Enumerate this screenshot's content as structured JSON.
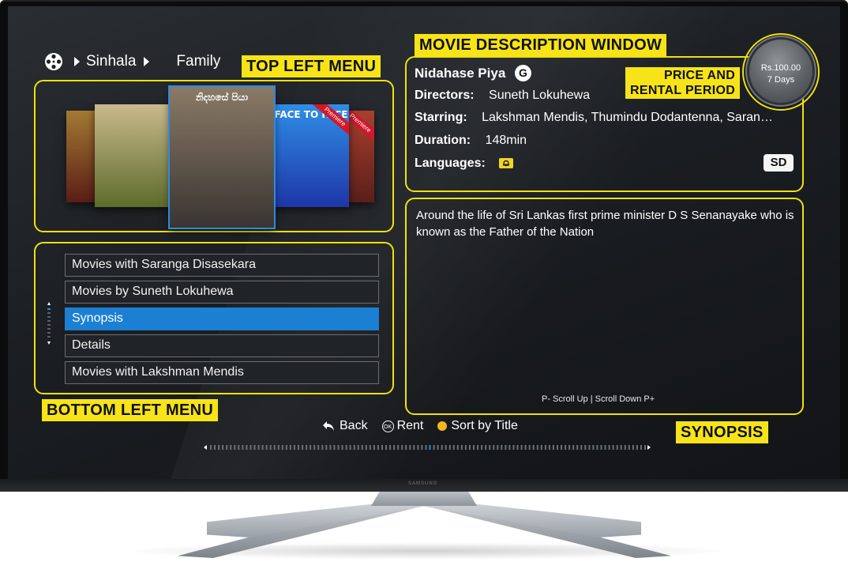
{
  "breadcrumb": {
    "items": [
      "Sinhala",
      "Family"
    ]
  },
  "callouts": {
    "top_left_menu": "TOP LEFT MENU",
    "bottom_left_menu": "BOTTOM LEFT MENU",
    "movie_description": "MOVIE DESCRIPTION WINDOW",
    "price_rental_line1": "PRICE AND",
    "price_rental_line2": "RENTAL PERIOD",
    "synopsis": "SYNOPSIS"
  },
  "posters": [
    {
      "title": "",
      "colors": [
        "#5a1d16",
        "#a37a34"
      ],
      "selected": false,
      "premiere": false
    },
    {
      "title": "",
      "colors": [
        "#5d6b2a",
        "#c9b98c"
      ],
      "selected": false,
      "premiere": false
    },
    {
      "title": "නිදහසේ පියා",
      "colors": [
        "#3a3532",
        "#8a7a66"
      ],
      "selected": true,
      "premiere": false
    },
    {
      "title": "FACE TO FACE",
      "colors": [
        "#1e36a8",
        "#2f8ee6"
      ],
      "selected": false,
      "premiere": true
    },
    {
      "title": "",
      "colors": [
        "#5a1f1a",
        "#a8402d"
      ],
      "selected": false,
      "premiere": true
    }
  ],
  "premiere_label": "Premiere",
  "menu": {
    "items": [
      {
        "label": "Movies with Saranga Disasekara",
        "selected": false
      },
      {
        "label": "Movies by Suneth Lokuhewa",
        "selected": false
      },
      {
        "label": "Synopsis",
        "selected": true
      },
      {
        "label": "Details",
        "selected": false
      },
      {
        "label": "Movies with Lakshman Mendis",
        "selected": false
      }
    ]
  },
  "movie": {
    "title": "Nidahase Piya",
    "rating": "G",
    "directors_label": "Directors:",
    "directors": "Suneth Lokuhewa",
    "starring_label": "Starring:",
    "starring": "Lakshman Mendis, Thumindu Dodantenna, Saran…",
    "duration_label": "Duration:",
    "duration": "148min",
    "languages_label": "Languages:",
    "quality": "SD"
  },
  "price": {
    "amount": "Rs.100.00",
    "period": "7 Days"
  },
  "synopsis": {
    "text": "Around the life of Sri Lankas first prime minister D S Senanayake who is known as the Father of the Nation",
    "scroll_hint": "P- Scroll Up | Scroll Down P+"
  },
  "footer": {
    "back": "Back",
    "ok_icon_label": "OK",
    "rent": "Rent",
    "sort": "Sort by Title"
  },
  "tv": {
    "brand": "SAMSUNG"
  },
  "colors": {
    "accent_yellow": "#f7e418",
    "selection_blue": "#1b7fd3"
  },
  "progress": {
    "position_fraction": 0.5
  }
}
